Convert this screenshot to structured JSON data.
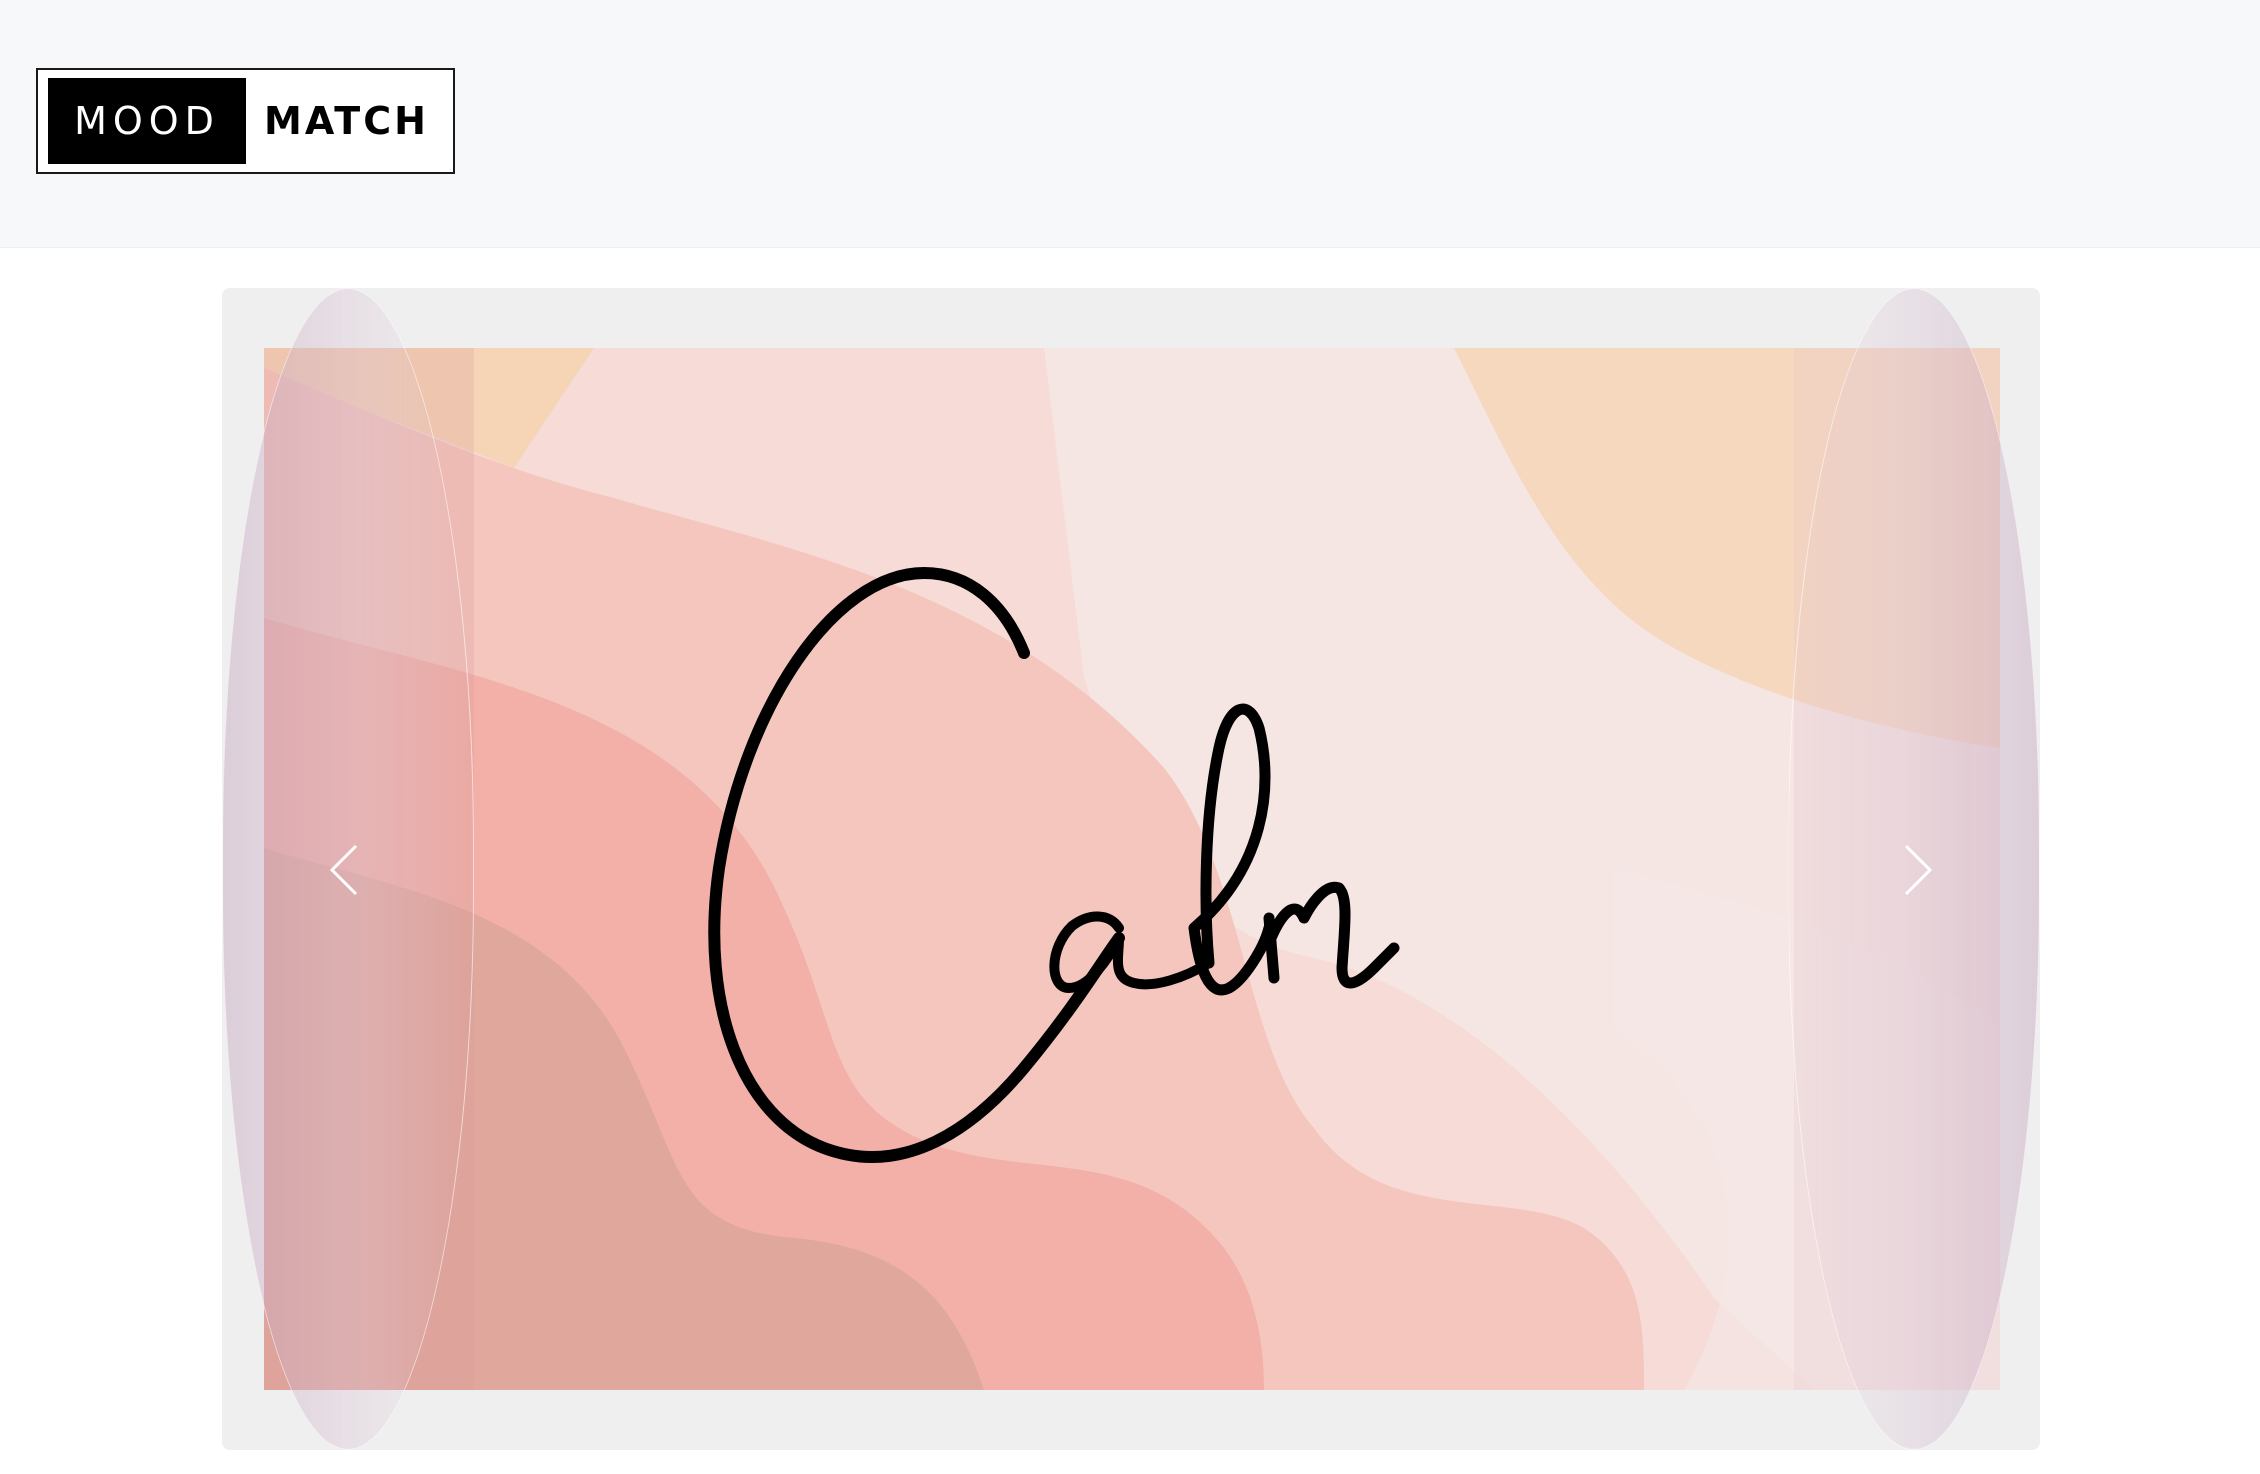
{
  "header": {
    "logo": {
      "part1": "MOOD",
      "part2": "MATCH"
    }
  },
  "carousel": {
    "slide": {
      "word": "Calm",
      "palette": [
        "#e9b4b3",
        "#f4c8c0",
        "#f6dbd6",
        "#f5e4e2",
        "#f6d8bf",
        "#e3a7a0",
        "#d99d97"
      ]
    },
    "prev_icon": "chevron-left-icon",
    "next_icon": "chevron-right-icon"
  }
}
